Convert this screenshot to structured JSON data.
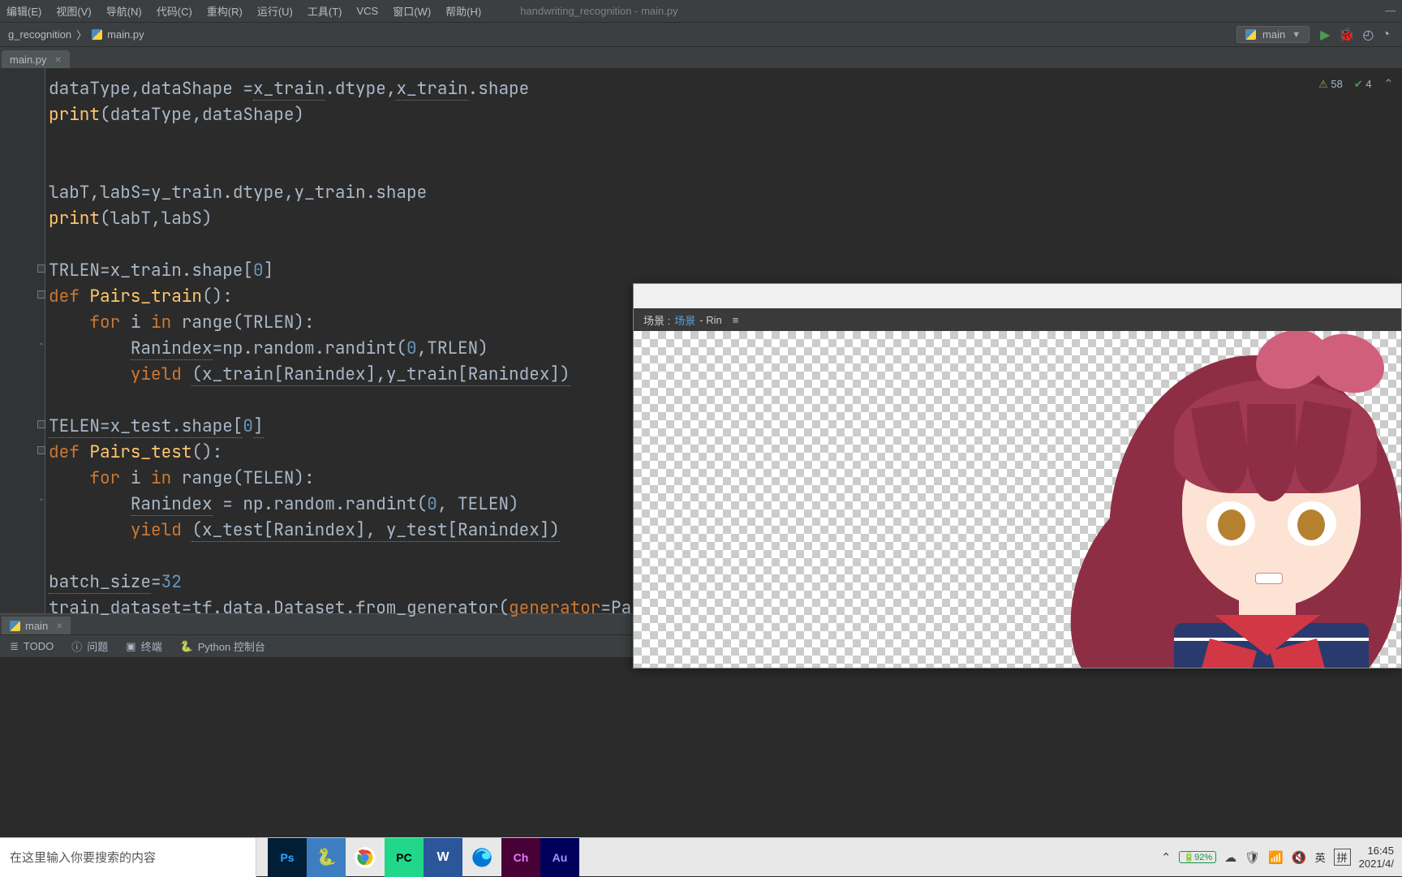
{
  "menu": {
    "edit": "编辑(E)",
    "view": "视图(V)",
    "navigate": "导航(N)",
    "code": "代码(C)",
    "refactor": "重构(R)",
    "run": "运行(U)",
    "tools": "工具(T)",
    "vcs": "VCS",
    "window": "窗口(W)",
    "help": "帮助(H)"
  },
  "window_title": "handwriting_recognition - main.py",
  "breadcrumb": {
    "project": "g_recognition",
    "file": "main.py"
  },
  "run_config": {
    "name": "main"
  },
  "inspections": {
    "warnings": "58",
    "typos": "4"
  },
  "tabs": {
    "editor_tab": "main.py",
    "run_tab": "main"
  },
  "tool_windows": {
    "todo": "TODO",
    "problems": "问题",
    "terminal": "终端",
    "python_console": "Python 控制台"
  },
  "code_lines": [
    {
      "t": "dataType,dataShape =x_train.dtype,x_train.shape",
      "plain": true
    },
    {
      "pre": "print",
      "pre_kw": true,
      "mid": "(dataType,dataShape)"
    },
    {
      "blank": true
    },
    {
      "blank": true
    },
    {
      "t": "labT,labS=y_train.dtype,y_train.shape",
      "under": true
    },
    {
      "pre": "print",
      "pre_kw": true,
      "mid": "(labT,labS)"
    },
    {
      "blank": true
    },
    {
      "t": "TRLEN=x_train.shape[",
      "num": "0",
      "tail": "]",
      "under": true
    },
    {
      "kw": "def ",
      "fn": "Pairs_train",
      "tail": "():"
    },
    {
      "indent": 1,
      "kw": "for ",
      "mid": "i ",
      "kw2": "in ",
      "call": "range",
      "tail": "(TRLEN):"
    },
    {
      "indent": 2,
      "t": "Ranindex=np.random.randint(",
      "num": "0",
      "mid2": ",TRLEN)"
    },
    {
      "indent": 2,
      "kw": "yield ",
      "under_t": "(x_train[Ranindex],y_train[Ranindex])"
    },
    {
      "blank": true
    },
    {
      "t": "TELEN=x_test.shape[",
      "num": "0",
      "tail": "]",
      "under": true
    },
    {
      "kw": "def ",
      "fn": "Pairs_test",
      "tail": "():"
    },
    {
      "indent": 1,
      "kw": "for ",
      "mid": "i ",
      "kw2": "in ",
      "call": "range",
      "tail": "(TELEN):"
    },
    {
      "indent": 2,
      "t": "Ranindex = np.random.randint(",
      "num": "0",
      "mid2": ", TELEN)"
    },
    {
      "indent": 2,
      "kw": "yield ",
      "under_t": "(x_test[Ranindex], y_test[Ranindex])"
    },
    {
      "blank": true
    },
    {
      "t": "batch_size=",
      "num": "32",
      "under": true
    },
    {
      "t": "train_dataset=tf.data.Dataset.from_generator(",
      "argkw": "generator",
      "tail2": "=Pairs"
    }
  ],
  "overlay": {
    "scene_label": "场景 :",
    "scene_link": "场景",
    "scene_name": "- Rin",
    "menu_icon": "≡"
  },
  "taskbar": {
    "search_placeholder": "在这里输入你要搜索的内容",
    "apps": {
      "ps": "Ps",
      "pc": "PC",
      "word": "W",
      "ch": "Ch",
      "au": "Au"
    }
  },
  "tray": {
    "battery": "92%",
    "ime1": "英",
    "ime2": "拼",
    "time": "16:45",
    "date": "2021/4/"
  }
}
